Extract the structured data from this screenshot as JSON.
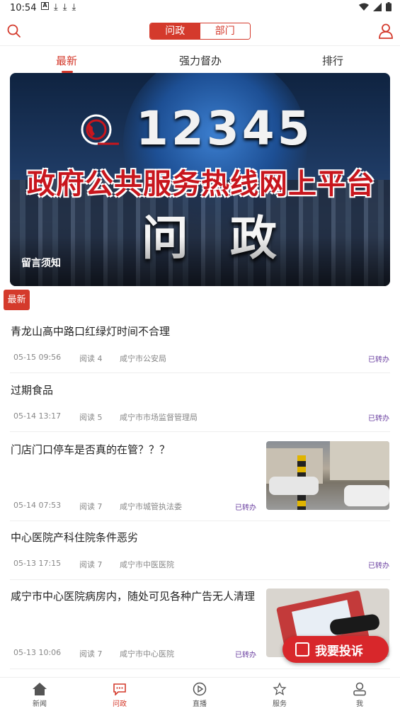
{
  "status_bar": {
    "time": "10:54"
  },
  "top_bar": {
    "segments": [
      "问政",
      "部门"
    ],
    "active_segment": 0
  },
  "tabs": {
    "items": [
      "最新",
      "强力督办",
      "排行"
    ],
    "active": 0
  },
  "banner": {
    "number": "12345",
    "subtitle": "政府公共服务热线网上平台",
    "big_text": "问 政",
    "caption": "留言须知"
  },
  "latest_tag": "最新",
  "items": [
    {
      "title": "青龙山高中路口红绿灯时间不合理",
      "date": "05-15 09:56",
      "reads": "阅读 4",
      "dept": "咸宁市公安局",
      "status": "已转办"
    },
    {
      "title": "过期食品",
      "date": "05-14 13:17",
      "reads": "阅读 5",
      "dept": "咸宁市市场监督管理局",
      "status": "已转办"
    },
    {
      "title": "门店门口停车是否真的在管？？？",
      "date": "05-14 07:53",
      "reads": "阅读 7",
      "dept": "咸宁市城管执法委",
      "status": "已转办"
    },
    {
      "title": "中心医院产科住院条件恶劣",
      "date": "05-13 17:15",
      "reads": "阅读 7",
      "dept": "咸宁市中医医院",
      "status": "已转办"
    },
    {
      "title": "咸宁市中心医院病房内，随处可见各种广告无人清理",
      "date": "05-13 10:06",
      "reads": "阅读 7",
      "dept": "咸宁市中心医院",
      "status": "已转办"
    }
  ],
  "fab": {
    "label": "我要投诉"
  },
  "bottom_nav": {
    "items": [
      "新闻",
      "问政",
      "直播",
      "服务",
      "我"
    ],
    "active": 1
  },
  "colors": {
    "accent": "#d43a2c",
    "status": "#6a3fa0"
  }
}
